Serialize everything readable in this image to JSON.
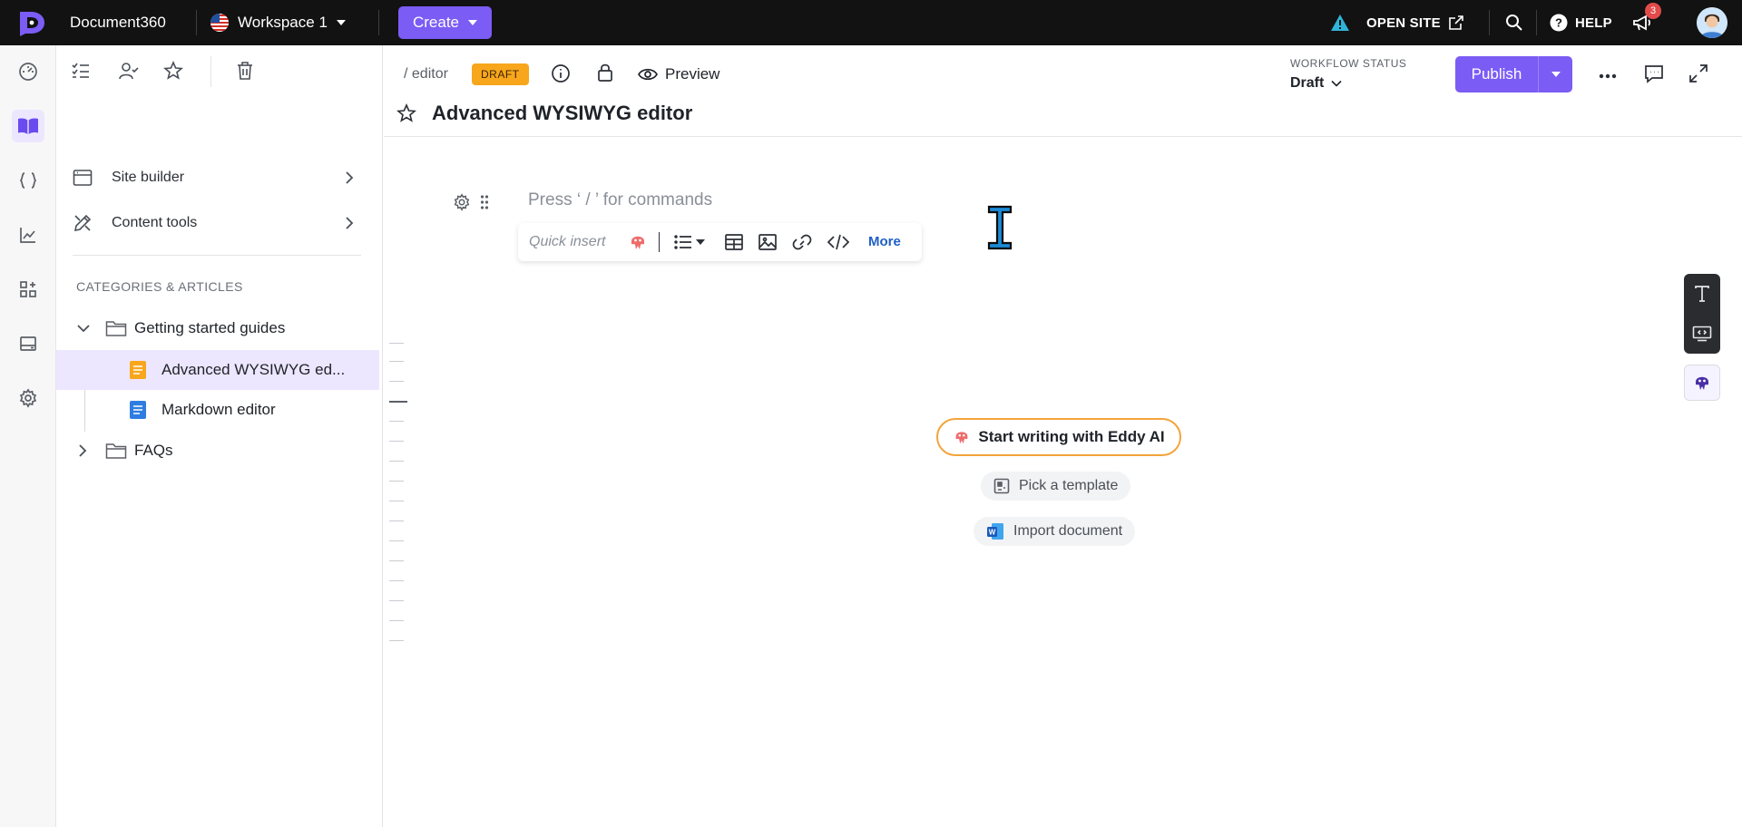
{
  "topbar": {
    "app_name": "Document360",
    "workspace": "Workspace 1",
    "create_label": "Create",
    "open_site_label": "OPEN SITE",
    "help_label": "HELP",
    "notification_count": "3"
  },
  "sidebar": {
    "nav": [
      {
        "label": "Site builder"
      },
      {
        "label": "Content tools"
      }
    ],
    "section_heading": "CATEGORIES & ARTICLES",
    "tree": {
      "category_1": "Getting started guides",
      "article_1": "Advanced WYSIWYG ed...",
      "article_2": "Markdown editor",
      "category_2": "FAQs"
    }
  },
  "editor_header": {
    "breadcrumb": "/ editor",
    "status_badge": "DRAFT",
    "preview_label": "Preview",
    "workflow_label": "WORKFLOW STATUS",
    "workflow_value": "Draft",
    "publish_label": "Publish",
    "article_title": "Advanced WYSIWYG editor"
  },
  "editor": {
    "placeholder": "Press ‘ / ’ for commands",
    "quick_insert_label": "Quick insert",
    "more_label": "More",
    "eddy_label": "Start writing with Eddy AI",
    "template_label": "Pick a template",
    "import_label": "Import document"
  },
  "colors": {
    "accent": "#7b5cf5",
    "draft": "#f8a61c",
    "topbar": "#121212"
  }
}
